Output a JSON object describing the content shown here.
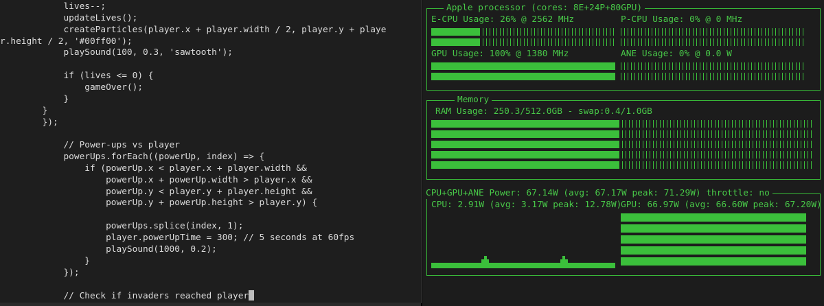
{
  "editor": {
    "lines": [
      {
        "indent": "            ",
        "text": "lives--;"
      },
      {
        "indent": "            ",
        "text": "updateLives();"
      },
      {
        "indent": "            ",
        "text": "createParticles(player.x + player.width / 2, player.y + playe"
      },
      {
        "indent": "",
        "text": "r.height / 2, '#00ff00');"
      },
      {
        "indent": "            ",
        "text": "playSound(100, 0.3, 'sawtooth');"
      },
      {
        "indent": "",
        "text": ""
      },
      {
        "indent": "            ",
        "text": "if (lives <= 0) {"
      },
      {
        "indent": "                ",
        "text": "gameOver();"
      },
      {
        "indent": "            ",
        "text": "}"
      },
      {
        "indent": "        ",
        "text": "}"
      },
      {
        "indent": "    ",
        "text": "    });"
      },
      {
        "indent": "",
        "text": ""
      },
      {
        "indent": "            ",
        "text": "// Power-ups vs player"
      },
      {
        "indent": "            ",
        "text": "powerUps.forEach((powerUp, index) => {"
      },
      {
        "indent": "                ",
        "text": "if (powerUp.x < player.x + player.width &&"
      },
      {
        "indent": "                    ",
        "text": "powerUp.x + powerUp.width > player.x &&"
      },
      {
        "indent": "                    ",
        "text": "powerUp.y < player.y + player.height &&"
      },
      {
        "indent": "                    ",
        "text": "powerUp.y + powerUp.height > player.y) {"
      },
      {
        "indent": "",
        "text": ""
      },
      {
        "indent": "                    ",
        "text": "powerUps.splice(index, 1);"
      },
      {
        "indent": "                    ",
        "text": "player.powerUpTime = 300; // 5 seconds at 60fps"
      },
      {
        "indent": "                    ",
        "text": "playSound(1000, 0.2);"
      },
      {
        "indent": "                ",
        "text": "}"
      },
      {
        "indent": "            ",
        "text": "});"
      },
      {
        "indent": "",
        "text": ""
      },
      {
        "indent": "            ",
        "text": "// Check if invaders reached player"
      }
    ]
  },
  "monitor": {
    "processor": {
      "title": "Apple processor (cores: 8E+24P+80GPU)",
      "ecpu_label": "E-CPU Usage: 26% @ 2562 MHz",
      "ecpu_usage": 0.26,
      "pcpu_label": "P-CPU Usage: 0% @ 0 MHz",
      "pcpu_usage": 0.0,
      "gpu_label": "GPU Usage: 100% @ 1380 MHz",
      "gpu_usage": 1.0,
      "ane_label": "ANE Usage: 0% @ 0.0 W",
      "ane_usage": 0.0
    },
    "memory": {
      "title": "Memory",
      "ram_label": "RAM Usage: 250.3/512.0GB - swap:0.4/1.0GB",
      "ram_usage": 0.489
    },
    "power": {
      "title": "CPU+GPU+ANE Power: 67.14W (avg: 67.17W peak: 71.29W) throttle: no",
      "cpu_label": "CPU: 2.91W (avg: 3.17W peak: 12.78W)",
      "gpu_label": "GPU: 66.97W (avg: 66.60W peak: 67.20W)",
      "cpu_history": [
        1,
        1,
        1,
        1,
        1,
        1,
        1,
        1,
        1,
        1,
        1,
        1,
        1,
        1,
        1,
        1,
        1,
        1,
        1,
        2,
        3,
        2,
        1,
        1,
        1,
        1,
        1,
        1,
        1,
        1,
        1,
        1,
        1,
        1,
        1,
        1,
        1,
        1,
        1,
        1,
        1,
        1,
        1,
        1,
        1,
        1,
        1,
        1,
        1,
        2,
        3,
        2,
        1,
        1,
        1,
        1,
        1,
        1,
        1,
        1,
        1,
        1,
        1,
        1,
        1,
        1,
        1,
        1,
        1,
        1
      ],
      "gpu_level": 0.95
    }
  }
}
